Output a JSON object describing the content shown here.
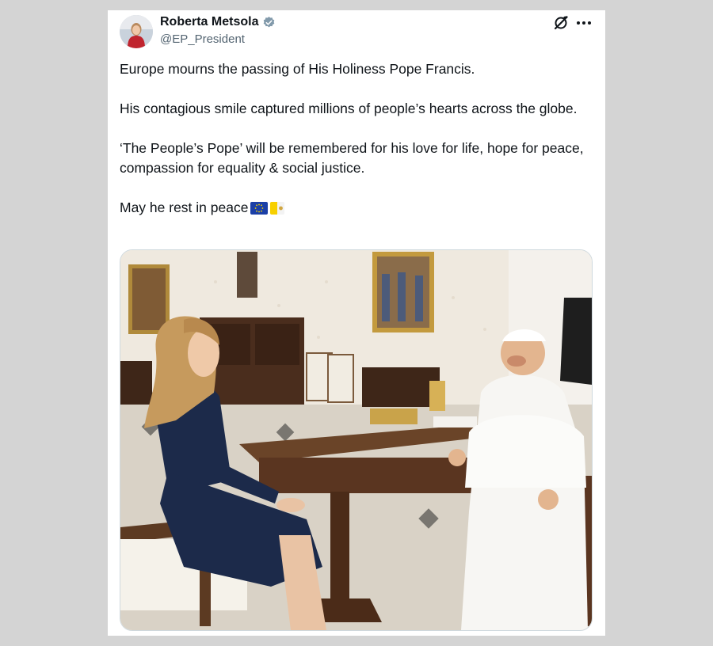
{
  "author": {
    "display_name": "Roberta Metsola",
    "handle": "@EP_President",
    "verified": true
  },
  "icons": {
    "verified": "verified-badge-icon",
    "grok": "grok-icon",
    "more": "more-options-icon"
  },
  "tweet": {
    "paragraphs": [
      "Europe mourns the passing of His Holiness Pope Francis.",
      "His contagious smile captured millions of people’s hearts across the globe.",
      "‘The People’s Pope’ will be remembered for his love for life, hope for peace, compassion for equality & social justice.",
      "May he rest in peace"
    ],
    "emoji": [
      "eu-flag",
      "vatican-flag"
    ]
  },
  "colors": {
    "verified_badge": "#829aab",
    "text_primary": "#0f1419",
    "text_secondary": "#536471",
    "background": "#d4d4d4"
  }
}
